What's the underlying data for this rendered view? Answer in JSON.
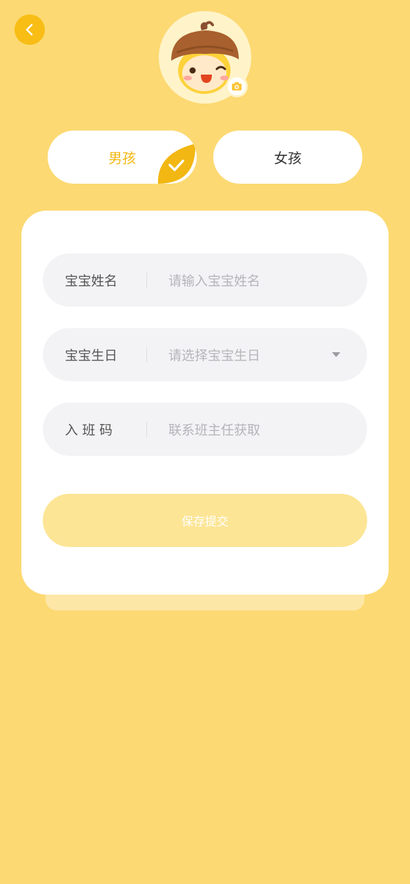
{
  "header": {
    "back_icon": "chevron-left-icon",
    "camera_icon": "camera-icon"
  },
  "gender": {
    "boy_label": "男孩",
    "girl_label": "女孩",
    "selected": "boy",
    "selected_color": "#F2B712"
  },
  "form": {
    "name": {
      "label": "宝宝姓名",
      "placeholder": "请输入宝宝姓名"
    },
    "birthday": {
      "label": "宝宝生日",
      "placeholder": "请选择宝宝生日"
    },
    "class_code": {
      "label": "入班码",
      "placeholder": "联系班主任获取"
    },
    "submit_label": "保存提交"
  },
  "colors": {
    "background": "#FCD972",
    "accent": "#F8BE16"
  }
}
